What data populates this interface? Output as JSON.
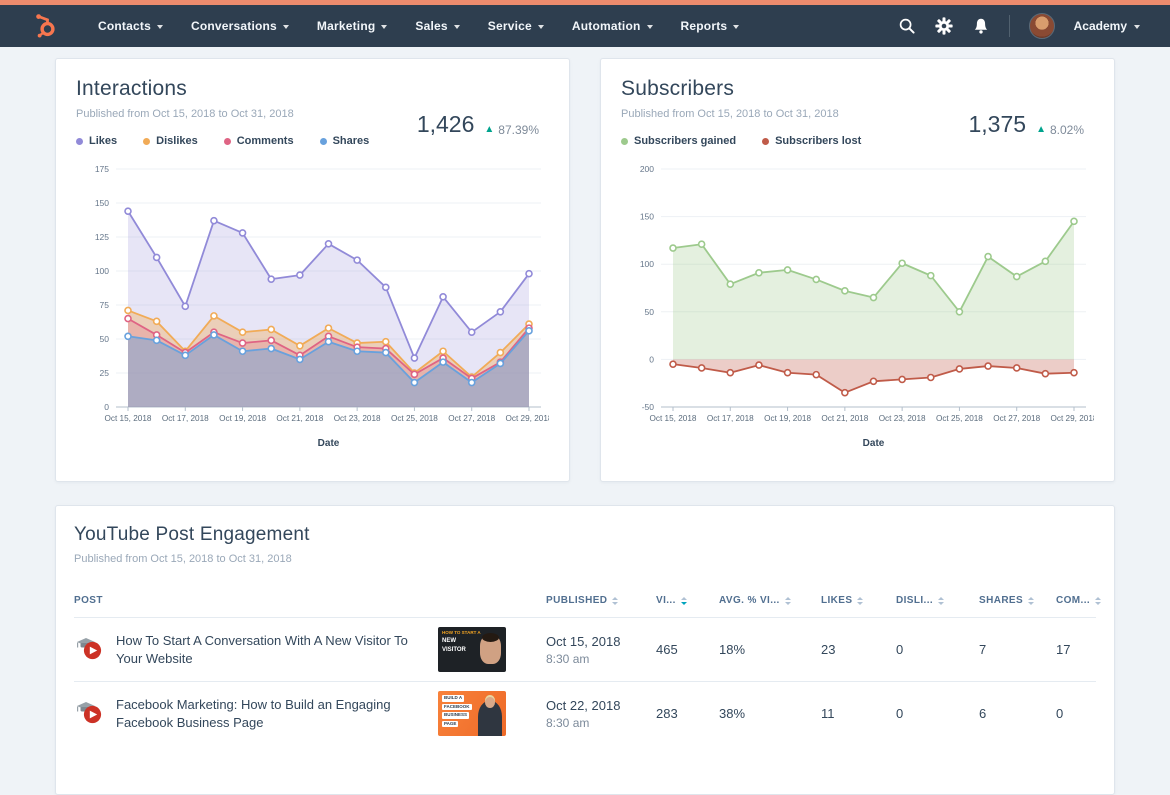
{
  "nav": {
    "menu_items": [
      "Contacts",
      "Conversations",
      "Marketing",
      "Sales",
      "Service",
      "Automation",
      "Reports"
    ],
    "account_label": "Academy",
    "icons": [
      {
        "name": "search-icon"
      },
      {
        "name": "settings-gear-icon"
      },
      {
        "name": "notifications-bell-icon"
      }
    ],
    "brand_color": "#ff7a59",
    "bar_color": "#2e3e4f",
    "accent_strip_color": "#ec8b6d"
  },
  "interactions": {
    "title": "Interactions",
    "subtitle": "Published from Oct 15, 2018 to Oct 31, 2018",
    "total": "1,426",
    "delta_pct": "87.39%",
    "delta_direction": "up",
    "delta_color": "#00a38d",
    "legend": [
      {
        "label": "Likes",
        "color": "#918ad8"
      },
      {
        "label": "Dislikes",
        "color": "#f1ab57"
      },
      {
        "label": "Comments",
        "color": "#df6484"
      },
      {
        "label": "Shares",
        "color": "#68a1dd"
      }
    ]
  },
  "subscribers": {
    "title": "Subscribers",
    "subtitle": "Published from Oct 15, 2018 to Oct 31, 2018",
    "total": "1,375",
    "delta_pct": "8.02%",
    "delta_direction": "up",
    "delta_color": "#00a38d",
    "legend": [
      {
        "label": "Subscribers gained",
        "color": "#9dca8d"
      },
      {
        "label": "Subscribers lost",
        "color": "#c05b49"
      }
    ]
  },
  "engagement_table": {
    "title": "YouTube Post Engagement",
    "subtitle": "Published from Oct 15, 2018 to Oct 31, 2018",
    "columns": [
      {
        "label": "POST",
        "sortable": false,
        "active": false
      },
      {
        "label": "PUBLISHED",
        "sortable": true,
        "active": false
      },
      {
        "label": "VI...",
        "sortable": true,
        "active": true
      },
      {
        "label": "AVG. % VI...",
        "sortable": true,
        "active": false
      },
      {
        "label": "LIKES",
        "sortable": true,
        "active": false
      },
      {
        "label": "DISLI...",
        "sortable": true,
        "active": false
      },
      {
        "label": "SHARES",
        "sortable": true,
        "active": false
      },
      {
        "label": "COM...",
        "sortable": true,
        "active": false
      }
    ],
    "rows": [
      {
        "title": "How To Start A Conversation With A New Visitor To Your Website",
        "thumbnail": {
          "style": "dark",
          "lines": [
            "HOW TO START A",
            "NEW",
            "VISITOR"
          ]
        },
        "published_date": "Oct 15, 2018",
        "published_time": "8:30 am",
        "views": "465",
        "avg_viewed": "18%",
        "likes": "23",
        "dislikes": "0",
        "shares": "7",
        "comments": "17"
      },
      {
        "title": "Facebook Marketing: How to Build an Engaging Facebook Business Page",
        "thumbnail": {
          "style": "orange",
          "lines": [
            "BUILD A",
            "FACEBOOK",
            "BUSINESS",
            "PAGE"
          ]
        },
        "published_date": "Oct 22, 2018",
        "published_time": "8:30 am",
        "views": "283",
        "avg_viewed": "38%",
        "likes": "11",
        "dislikes": "0",
        "shares": "6",
        "comments": "0"
      }
    ]
  },
  "chart_data": [
    {
      "type": "area",
      "title": "Interactions",
      "xlabel": "Date",
      "x": [
        "Oct 15, 2018",
        "Oct 16, 2018",
        "Oct 17, 2018",
        "Oct 18, 2018",
        "Oct 19, 2018",
        "Oct 20, 2018",
        "Oct 21, 2018",
        "Oct 22, 2018",
        "Oct 23, 2018",
        "Oct 24, 2018",
        "Oct 25, 2018",
        "Oct 26, 2018",
        "Oct 27, 2018",
        "Oct 28, 2018",
        "Oct 29, 2018"
      ],
      "x_tick_every": 2,
      "ylim": [
        0,
        175
      ],
      "yticks": [
        0,
        25,
        50,
        75,
        100,
        125,
        150,
        175
      ],
      "grid": true,
      "legend_position": "top-left",
      "series": [
        {
          "name": "Likes",
          "color": "#918ad8",
          "fill_alpha": 0.22,
          "values": [
            144,
            110,
            74,
            137,
            128,
            94,
            97,
            120,
            108,
            88,
            36,
            81,
            55,
            70,
            98
          ]
        },
        {
          "name": "Dislikes",
          "color": "#f1ab57",
          "fill_alpha": 0.38,
          "values": [
            71,
            63,
            41,
            67,
            55,
            57,
            45,
            58,
            47,
            48,
            25,
            41,
            22,
            40,
            61
          ]
        },
        {
          "name": "Comments",
          "color": "#df6484",
          "fill_alpha": 0.25,
          "values": [
            65,
            53,
            40,
            55,
            47,
            49,
            38,
            52,
            44,
            43,
            24,
            36,
            21,
            33,
            58
          ]
        },
        {
          "name": "Shares",
          "color": "#68a1dd",
          "fill_alpha": 0.45,
          "values": [
            52,
            49,
            38,
            53,
            41,
            43,
            35,
            48,
            41,
            40,
            18,
            33,
            18,
            32,
            56
          ]
        }
      ]
    },
    {
      "type": "area",
      "title": "Subscribers",
      "xlabel": "Date",
      "x": [
        "Oct 15, 2018",
        "Oct 16, 2018",
        "Oct 17, 2018",
        "Oct 18, 2018",
        "Oct 19, 2018",
        "Oct 20, 2018",
        "Oct 21, 2018",
        "Oct 22, 2018",
        "Oct 23, 2018",
        "Oct 24, 2018",
        "Oct 25, 2018",
        "Oct 26, 2018",
        "Oct 27, 2018",
        "Oct 28, 2018",
        "Oct 29, 2018"
      ],
      "x_tick_every": 2,
      "ylim": [
        -50,
        200
      ],
      "yticks": [
        -50,
        0,
        50,
        100,
        150,
        200
      ],
      "grid": true,
      "legend_position": "top-left",
      "series": [
        {
          "name": "Subscribers gained",
          "color": "#9dca8d",
          "fill_alpha": 0.28,
          "values": [
            117,
            121,
            79,
            91,
            94,
            84,
            72,
            65,
            101,
            88,
            50,
            108,
            87,
            103,
            145
          ]
        },
        {
          "name": "Subscribers lost",
          "color": "#c05b49",
          "fill_alpha": 0.3,
          "values": [
            -5,
            -9,
            -14,
            -6,
            -14,
            -16,
            -35,
            -23,
            -21,
            -19,
            -10,
            -7,
            -9,
            -15,
            -14
          ]
        }
      ]
    }
  ]
}
